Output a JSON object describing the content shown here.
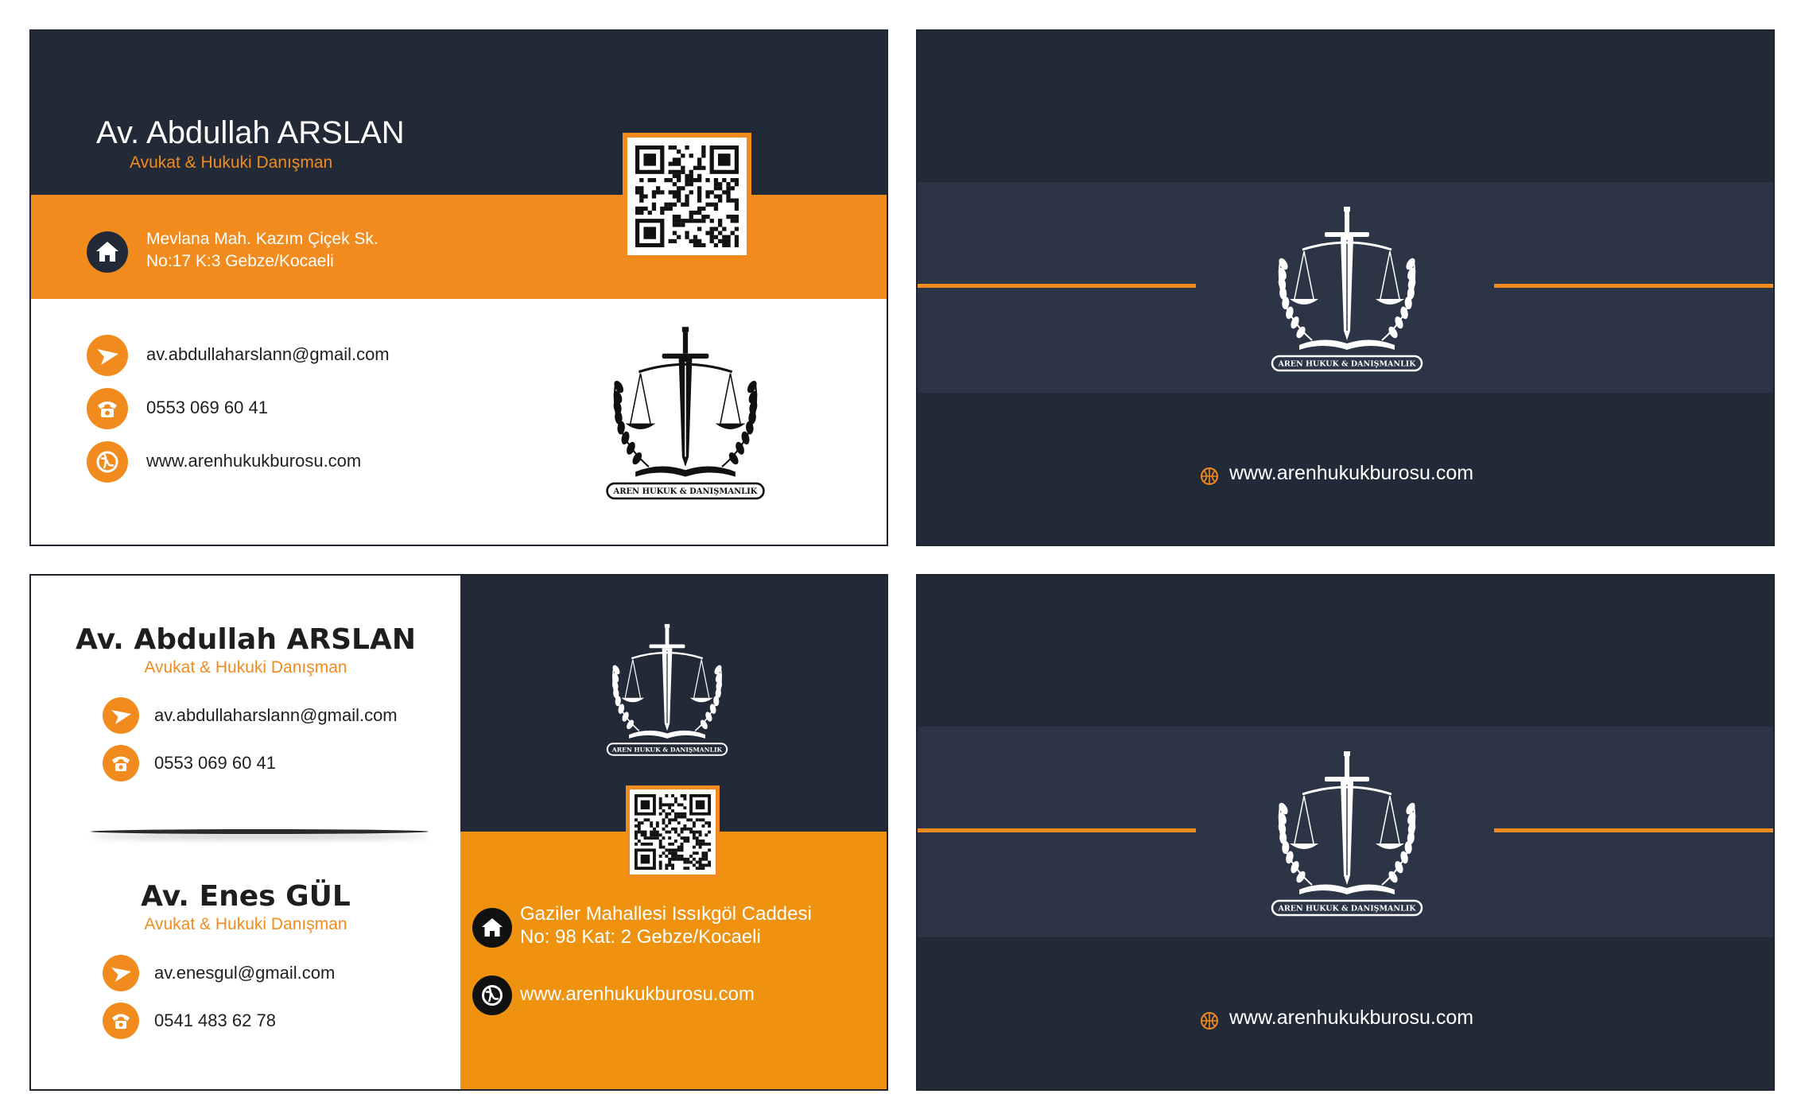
{
  "card1": {
    "name": "Av. Abdullah ARSLAN",
    "title": "Avukat & Hukuki Danışman",
    "address_line1": "Mevlana Mah. Kazım Çiçek Sk.",
    "address_line2": "No:17 K:3 Gebze/Kocaeli",
    "email": "av.abdullaharslann@gmail.com",
    "phone": "0553 069 60 41",
    "website": "www.arenhukukburosu.com",
    "logo_text": "AREN HUKUK & DANIŞMANLIK"
  },
  "card2": {
    "logo_text": "AREN HUKUK & DANIŞMANLIK",
    "website": "www.arenhukukburosu.com"
  },
  "card3": {
    "person1": {
      "name": "Av. Abdullah ARSLAN",
      "title": "Avukat & Hukuki Danışman",
      "email": "av.abdullaharslann@gmail.com",
      "phone": "0553 069 60 41"
    },
    "person2": {
      "name": "Av. Enes GÜL",
      "title": "Avukat & Hukuki Danışman",
      "email": "av.enesgul@gmail.com",
      "phone": "0541 483 62 78"
    },
    "logo_text": "AREN HUKUK & DANIŞMANLIK",
    "address_line1": "Gaziler Mahallesi Issıkgöl Caddesi",
    "address_line2": "No: 98 Kat: 2 Gebze/Kocaeli",
    "website": "www.arenhukukburosu.com"
  },
  "card4": {
    "logo_text": "AREN HUKUK & DANIŞMANLIK",
    "website": "www.arenhukukburosu.com"
  },
  "colors": {
    "navy": "#232a37",
    "band_navy": "#2b3546",
    "orange": "#f28b1e",
    "orange_dark": "#ee9210",
    "white": "#ffffff"
  },
  "icons": [
    "home-icon",
    "send-icon",
    "phone-icon",
    "globe-icon",
    "qr-code",
    "justice-logo"
  ]
}
